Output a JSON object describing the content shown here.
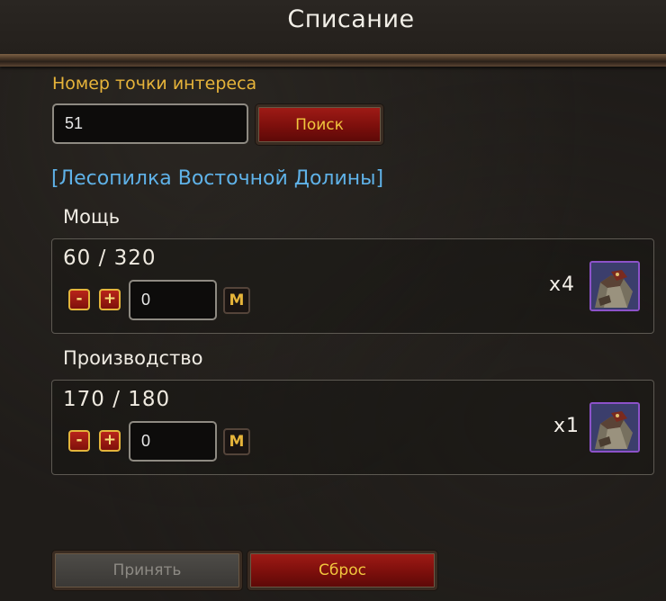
{
  "window": {
    "title": "Списание"
  },
  "poi": {
    "label": "Номер точки интереса",
    "input_value": "51",
    "search_label": "Поиск"
  },
  "location_name": "[Лесопилка Восточной Долины]",
  "resources": [
    {
      "label": "Мощь",
      "value": "60 / 320",
      "minus_label": "-",
      "plus_label": "+",
      "amount": "0",
      "max_label": "M",
      "multiplier": "x4",
      "icon": "armored-gauntlet-icon"
    },
    {
      "label": "Производство",
      "value": "170 / 180",
      "minus_label": "-",
      "plus_label": "+",
      "amount": "0",
      "max_label": "M",
      "multiplier": "x1",
      "icon": "armored-gauntlet-icon"
    }
  ],
  "footer": {
    "accept_label": "Принять",
    "reset_label": "Сброс"
  },
  "colors": {
    "accent_gold": "#e7b43a",
    "link_blue": "#5fb2e8",
    "button_red": "#8c1410",
    "icon_border_purple": "#8c52c9"
  }
}
